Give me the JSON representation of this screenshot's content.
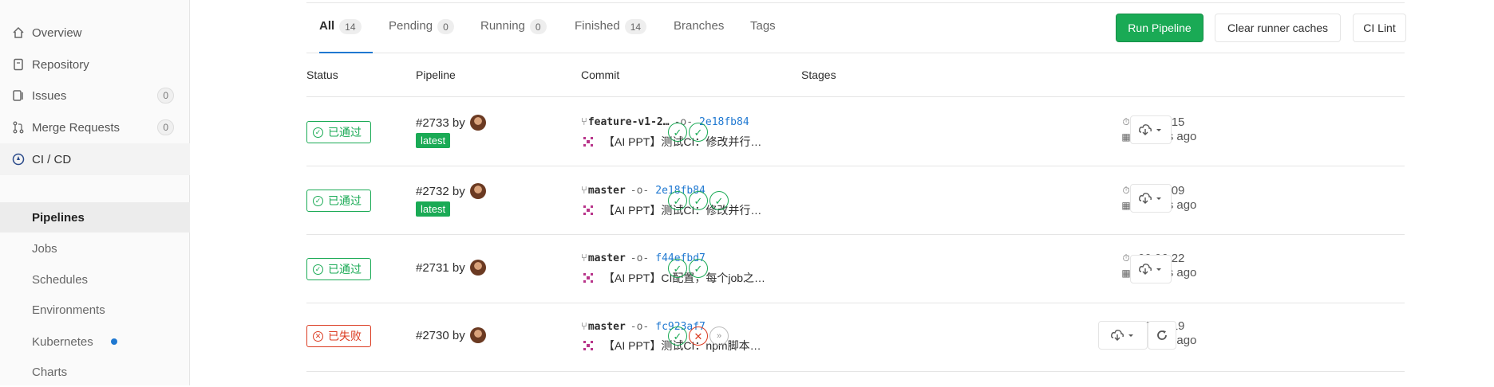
{
  "sidebar": {
    "items": [
      {
        "label": "Overview",
        "icon": "home-icon"
      },
      {
        "label": "Repository",
        "icon": "doc-icon"
      },
      {
        "label": "Issues",
        "icon": "issues-icon",
        "count": "0"
      },
      {
        "label": "Merge Requests",
        "icon": "merge-icon",
        "count": "0"
      },
      {
        "label": "CI / CD",
        "icon": "rocket-icon"
      }
    ],
    "sub_items": [
      {
        "label": "Pipelines"
      },
      {
        "label": "Jobs"
      },
      {
        "label": "Schedules"
      },
      {
        "label": "Environments"
      },
      {
        "label": "Kubernetes"
      },
      {
        "label": "Charts"
      }
    ]
  },
  "tabs": [
    {
      "label": "All",
      "count": "14"
    },
    {
      "label": "Pending",
      "count": "0"
    },
    {
      "label": "Running",
      "count": "0"
    },
    {
      "label": "Finished",
      "count": "14"
    },
    {
      "label": "Branches"
    },
    {
      "label": "Tags"
    }
  ],
  "buttons": {
    "run": "Run Pipeline",
    "clear": "Clear runner caches",
    "lint": "CI Lint"
  },
  "columns": {
    "status": "Status",
    "pipeline": "Pipeline",
    "commit": "Commit",
    "stages": "Stages"
  },
  "colors": {
    "success": "#1aaa55",
    "failed": "#db3b21",
    "link": "#1f78d1"
  },
  "rows": [
    {
      "status": "已通过",
      "status_type": "passed",
      "id": "#2733 by",
      "latest": "latest",
      "branch": "feature-v1-2…",
      "sha": "2e18fb84",
      "message": "【AI PPT】测试CI：修改并行…",
      "stages": [
        "success",
        "success"
      ],
      "duration": "00:04:15",
      "finished": "2 days ago"
    },
    {
      "status": "已通过",
      "status_type": "passed",
      "id": "#2732 by",
      "latest": "latest",
      "branch": "master",
      "sha": "2e18fb84",
      "message": "【AI PPT】测试CI：修改并行…",
      "stages": [
        "success",
        "success",
        "success"
      ],
      "duration": "00:06:09",
      "finished": "2 days ago"
    },
    {
      "status": "已通过",
      "status_type": "passed",
      "id": "#2731 by",
      "branch": "master",
      "sha": "f44efbd7",
      "message": "【AI PPT】CI配置，每个job之…",
      "stages": [
        "success",
        "success"
      ],
      "duration": "00:06:22",
      "finished": "2 days ago"
    },
    {
      "status": "已失败",
      "status_type": "failed",
      "id": "#2730 by",
      "branch": "master",
      "sha": "fc923af7",
      "message": "【AI PPT】测试CI：npm脚本…",
      "stages": [
        "success",
        "failed",
        "skipped"
      ],
      "duration": "00:02:19",
      "finished": "2 days ago"
    }
  ]
}
